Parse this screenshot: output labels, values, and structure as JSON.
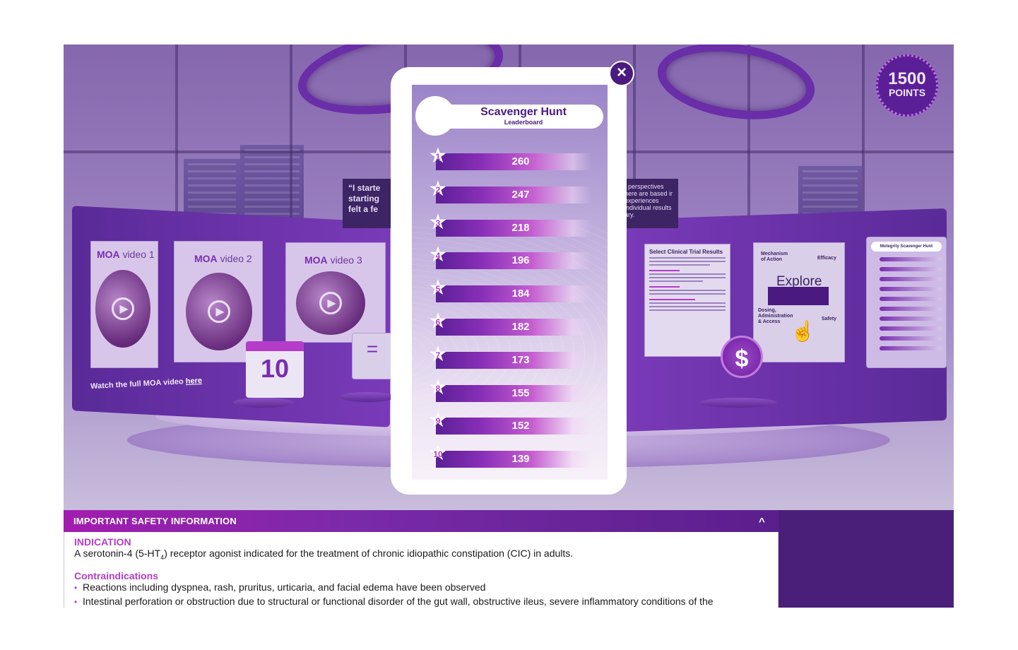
{
  "points": {
    "value": "1500",
    "label": "POINTS"
  },
  "scene": {
    "videos": [
      {
        "brand": "MOA",
        "label": "video 1"
      },
      {
        "brand": "MOA",
        "label": "video 2"
      },
      {
        "brand": "MOA",
        "label": "video 3"
      }
    ],
    "watch_text": "Watch the full MOA video",
    "watch_link": "here",
    "quote_left": "“I starte starting felt a fe",
    "quote_right": "t perspectives here are based ir experiences individual results ary.",
    "calendar_day": "10",
    "clinical_title": "Select Clinical Trial Results",
    "explore_word": "Explore",
    "explore_labels": {
      "mechanism": "Mechanism of Action",
      "efficacy": "Efficacy",
      "dosing": "Dosing, Administration & Access",
      "safety": "Safety"
    },
    "mini_board_title": "Motegrity Scavenger Hunt",
    "dollar": "$"
  },
  "leaderboard": {
    "title": "Scavenger Hunt",
    "subtitle": "Leaderboard",
    "close_label": "×",
    "rows": [
      {
        "rank": "1",
        "score": "260"
      },
      {
        "rank": "2",
        "score": "247"
      },
      {
        "rank": "3",
        "score": "218"
      },
      {
        "rank": "4",
        "score": "196"
      },
      {
        "rank": "5",
        "score": "184"
      },
      {
        "rank": "6",
        "score": "182"
      },
      {
        "rank": "7",
        "score": "173"
      },
      {
        "rank": "8",
        "score": "155"
      },
      {
        "rank": "9",
        "score": "152"
      },
      {
        "rank": "10",
        "score": "139"
      }
    ]
  },
  "isi": {
    "title": "IMPORTANT SAFETY INFORMATION",
    "toggle": "^",
    "indication_heading": "INDICATION",
    "indication_pre": "A serotonin-4 (5-HT",
    "indication_sub": "4",
    "indication_post": ") receptor agonist indicated for the treatment of chronic idiopathic constipation (CIC) in adults.",
    "contra_heading": "Contraindications",
    "bullets": [
      "Reactions including dyspnea, rash, pruritus, urticaria, and facial edema have been observed",
      "Intestinal perforation or obstruction due to structural or functional disorder of the gut wall, obstructive ileus, severe inflammatory conditions of the"
    ]
  },
  "colors": {
    "brand_purple": "#4a1a80",
    "accent_magenta": "#b43cc8",
    "isi_header_start": "#a21caf"
  }
}
